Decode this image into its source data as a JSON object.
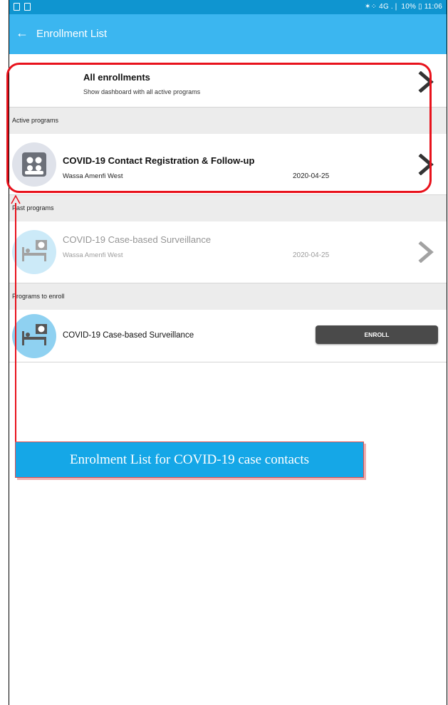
{
  "status_bar": {
    "right_text": "✶⁘ 4G .❘ 10% ▯ 11:06"
  },
  "app_bar": {
    "back_icon": "arrow-left-icon",
    "title": "Enrollment List"
  },
  "all_enrollments": {
    "title": "All enrollments",
    "subtitle": "Show dashboard with all active programs"
  },
  "sections": {
    "active": "Active programs",
    "past": "Past programs",
    "to_enroll": "Programs to enroll"
  },
  "active_programs": [
    {
      "name": "COVID-19 Contact Registration & Follow-up",
      "org_unit": "Wassa Amenfi West",
      "date": "2020-04-25",
      "icon": "people-icon"
    }
  ],
  "past_programs": [
    {
      "name": "COVID-19 Case-based Surveillance",
      "org_unit": "Wassa Amenfi West",
      "date": "2020-04-25",
      "icon": "patient-bed-icon"
    }
  ],
  "programs_to_enroll": [
    {
      "name": "COVID-19 Case-based Surveillance",
      "button_label": "ENROLL",
      "icon": "patient-bed-icon"
    }
  ],
  "annotation": {
    "callout_text": "Enrolment List for COVID-19 case contacts",
    "color": "#e8121c",
    "callout_bg": "#15a7e7"
  },
  "colors": {
    "status_bar": "#0f95d0",
    "app_bar": "#3bb6f0",
    "enroll_button": "#4a4a4a"
  }
}
